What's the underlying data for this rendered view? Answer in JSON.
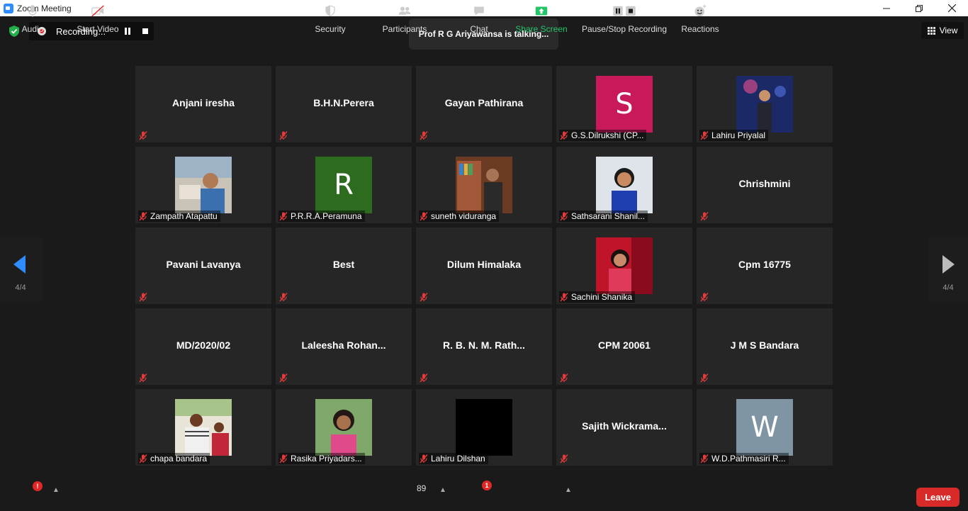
{
  "window": {
    "title": "Zoom Meeting"
  },
  "topbar": {
    "recording_label": "Recording...",
    "talking": "Prof R G Ariyawansa is talking...",
    "view_label": "View"
  },
  "pagination": {
    "left": "4/4",
    "right": "4/4"
  },
  "tiles": [
    {
      "name": "Anjani iresha"
    },
    {
      "name": "B.H.N.Perera"
    },
    {
      "name": "Gayan Pathirana"
    },
    {
      "label": "G.S.Dilrukshi (CP...",
      "letter": "S",
      "color": "#c8195a"
    },
    {
      "label": "Lahiru Priyalal"
    },
    {
      "label": "Zampath Atapattu"
    },
    {
      "label": "P.R.R.A.Peramuna",
      "letter": "R",
      "color": "#2d6b1f"
    },
    {
      "label": "suneth viduranga"
    },
    {
      "label": "Sathsarani Shanil..."
    },
    {
      "name": "Chrishmini"
    },
    {
      "name": "Pavani Lavanya"
    },
    {
      "name": "Best"
    },
    {
      "name": "Dilum Himalaka"
    },
    {
      "label": "Sachini Shanika"
    },
    {
      "name": "Cpm 16775"
    },
    {
      "name": "MD/2020/02"
    },
    {
      "name": "Laleesha  Rohan..."
    },
    {
      "name": "R. B. N. M. Rath..."
    },
    {
      "name": "CPM 20061"
    },
    {
      "name": "J M S Bandara"
    },
    {
      "label": "chapa bandara"
    },
    {
      "label": "Rasika Priyadars..."
    },
    {
      "label": "Lahiru Dilshan"
    },
    {
      "name": "Sajith  Wickrama..."
    },
    {
      "label": "W.D.Pathmasiri R...",
      "letter": "W",
      "color": "#7f95a3"
    }
  ],
  "toolbar": {
    "audio": "Audio",
    "audio_badge": "!",
    "start_video": "Start Video",
    "security": "Security",
    "participants": "Participants",
    "participants_count": "89",
    "chat": "Chat",
    "chat_badge": "1",
    "share_screen": "Share Screen",
    "pause_stop_recording": "Pause/Stop Recording",
    "reactions": "Reactions",
    "leave": "Leave"
  }
}
